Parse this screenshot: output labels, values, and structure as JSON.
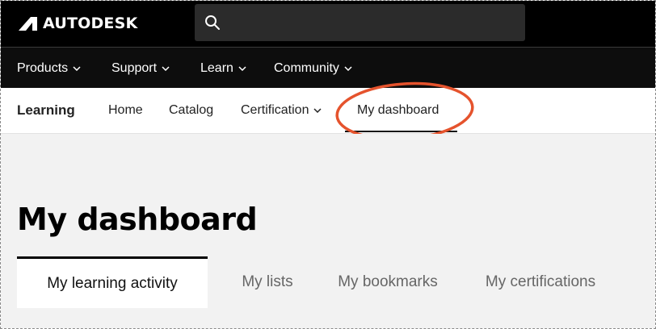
{
  "brand": {
    "name": "AUTODESK"
  },
  "search": {
    "value": "",
    "placeholder": ""
  },
  "main_nav": {
    "items": [
      {
        "label": "Products",
        "has_dropdown": true
      },
      {
        "label": "Support",
        "has_dropdown": true
      },
      {
        "label": "Learn",
        "has_dropdown": true
      },
      {
        "label": "Community",
        "has_dropdown": true
      }
    ]
  },
  "sub_nav": {
    "title": "Learning",
    "items": [
      {
        "label": "Home"
      },
      {
        "label": "Catalog"
      },
      {
        "label": "Certification",
        "has_dropdown": true
      },
      {
        "label": "My dashboard",
        "active": true
      }
    ]
  },
  "page": {
    "title": "My dashboard"
  },
  "tabs": [
    {
      "label": "My learning activity",
      "active": true
    },
    {
      "label": "My lists"
    },
    {
      "label": "My bookmarks"
    },
    {
      "label": "My certifications"
    }
  ],
  "colors": {
    "header_bg": "#000000",
    "search_bg": "#2b2b2b",
    "page_bg": "#f2f2f2",
    "highlight_annotation": "#e5532d"
  }
}
